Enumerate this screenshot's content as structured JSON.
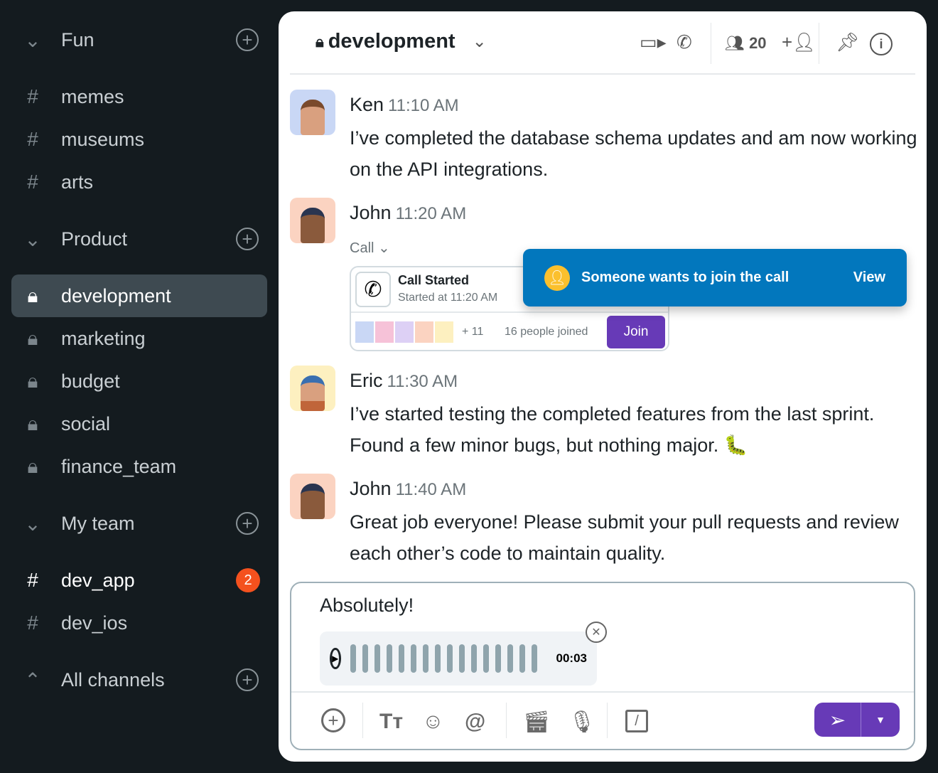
{
  "sidebar": {
    "groups": [
      {
        "label": "Fun",
        "expanded": true,
        "items": [
          {
            "label": "memes",
            "icon": "hash"
          },
          {
            "label": "museums",
            "icon": "hash"
          },
          {
            "label": "arts",
            "icon": "hash"
          }
        ]
      },
      {
        "label": "Product",
        "expanded": true,
        "items": [
          {
            "label": "development",
            "icon": "lock",
            "active": true
          },
          {
            "label": "marketing",
            "icon": "lock"
          },
          {
            "label": "budget",
            "icon": "lock"
          },
          {
            "label": "social",
            "icon": "lock"
          },
          {
            "label": "finance_team",
            "icon": "lock"
          }
        ]
      },
      {
        "label": "My team",
        "expanded": true,
        "items": [
          {
            "label": "dev_app",
            "icon": "hash",
            "badge": "2"
          },
          {
            "label": "dev_ios",
            "icon": "hash"
          }
        ]
      },
      {
        "label": "All channels",
        "expanded": false
      }
    ]
  },
  "header": {
    "channel": "development",
    "members": "20"
  },
  "messages": [
    {
      "author": "Ken",
      "time": "11:10 AM",
      "text": "I’ve completed the database schema updates and am now working on the API integrations."
    },
    {
      "author": "John",
      "time": "11:20 AM",
      "call_label": "Call"
    },
    {
      "author": "Eric",
      "time": "11:30 AM",
      "text": "I’ve started testing the completed features from the last sprint. Found a few minor bugs, but nothing major. 🐛"
    },
    {
      "author": "John",
      "time": "11:40 AM",
      "text": "Great job everyone! Please submit your pull requests and review each other’s code to maintain quality."
    }
  ],
  "call": {
    "title": "Call Started",
    "subtitle": "Started at 11:20 AM",
    "extra": "+ 11",
    "joined": "16 people joined",
    "join": "Join"
  },
  "toast": {
    "text": "Someone wants to join the call",
    "action": "View"
  },
  "composer": {
    "text": "Absolutely!",
    "audio_duration": "00:03"
  },
  "colors": {
    "accent": "#673ab7",
    "toast": "#0277bd",
    "badge": "#f4511e",
    "sidebar": "#141b1f"
  }
}
